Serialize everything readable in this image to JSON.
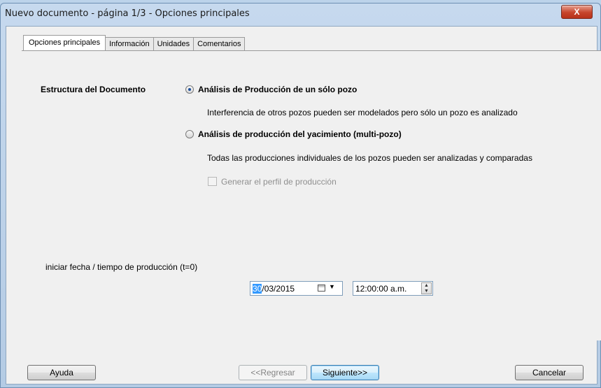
{
  "window": {
    "title": "Nuevo documento - página 1/3 - Opciones principales",
    "close_label": "X"
  },
  "tabs": [
    {
      "label": "Opciones principales",
      "active": true
    },
    {
      "label": "Información",
      "active": false
    },
    {
      "label": "Unidades",
      "active": false
    },
    {
      "label": "Comentarios",
      "active": false
    }
  ],
  "structure": {
    "label": "Estructura del Documento",
    "options": [
      {
        "label": "Análisis de Producción de un sólo pozo",
        "selected": true,
        "description": "Interferencia de otros pozos pueden ser modelados pero sólo un pozo es analizado"
      },
      {
        "label": "Análisis de producción del yacimiento (multi-pozo)",
        "selected": false,
        "description": "Todas las producciones individuales de los pozos pueden ser analizadas y comparadas"
      }
    ],
    "profile_checkbox": {
      "label": "Generar el perfil de producción",
      "checked": false,
      "enabled": false
    }
  },
  "start": {
    "label": "iniciar fecha / tiempo de producción (t=0)",
    "date_day": "30",
    "date_rest": "/03/2015",
    "time": "12:00:00 a.m."
  },
  "buttons": {
    "help": "Ayuda",
    "back": "<<Regresar",
    "next": "Siguiente>>",
    "cancel": "Cancelar"
  }
}
